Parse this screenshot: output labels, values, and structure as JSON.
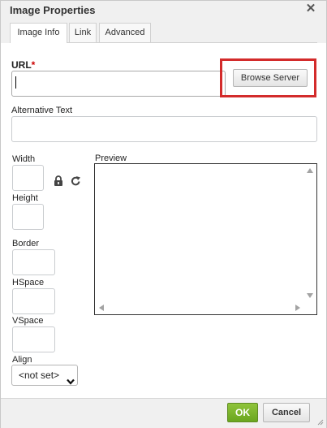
{
  "dialog": {
    "title": "Image Properties",
    "close_icon": "close-icon"
  },
  "tabs": [
    {
      "label": "Image Info",
      "active": true
    },
    {
      "label": "Link",
      "active": false
    },
    {
      "label": "Advanced",
      "active": false
    }
  ],
  "fields": {
    "url_label": "URL",
    "url_required": "*",
    "url_value": "",
    "browse_server_label": "Browse Server",
    "alt_text_label": "Alternative Text",
    "alt_text_value": "",
    "width_label": "Width",
    "width_value": "",
    "height_label": "Height",
    "height_value": "",
    "border_label": "Border",
    "border_value": "",
    "hspace_label": "HSpace",
    "hspace_value": "",
    "vspace_label": "VSpace",
    "vspace_value": "",
    "align_label": "Align",
    "align_value": "<not set>",
    "lock_icon": "lock-icon",
    "reset_icon": "reset-size-icon"
  },
  "preview": {
    "label": "Preview"
  },
  "footer": {
    "ok_label": "OK",
    "cancel_label": "Cancel"
  },
  "colors": {
    "highlight": "#d32b2b",
    "ok_button": "#7cb72d",
    "titlebar": "#f0f0f0"
  }
}
